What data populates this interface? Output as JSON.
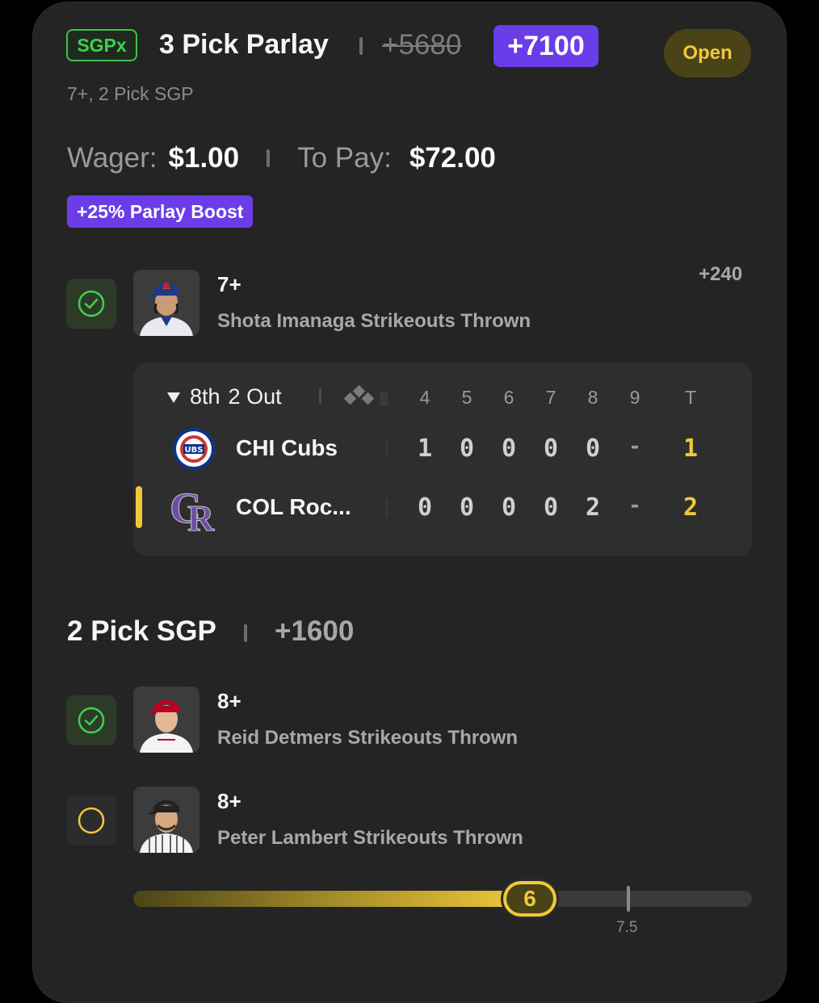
{
  "header": {
    "badge": "SGPx",
    "title": "3 Pick Parlay",
    "original_odds": "+5680",
    "boosted_odds": "+7100",
    "status": "Open",
    "subtitle": "7+, 2 Pick SGP"
  },
  "wager": {
    "wager_label": "Wager:",
    "wager_value": "$1.00",
    "payout_label": "To Pay:",
    "payout_value": "$72.00",
    "boost_label": "+25% Parlay Boost"
  },
  "picks": [
    {
      "line": "7+",
      "description": "Shota Imanaga Strikeouts Thrown",
      "odds": "+240",
      "status": "won"
    },
    {
      "line": "8+",
      "description": "Reid Detmers Strikeouts Thrown",
      "status": "won"
    },
    {
      "line": "8+",
      "description": "Peter Lambert Strikeouts Thrown",
      "status": "open"
    }
  ],
  "scoreboard": {
    "inning": "8th",
    "outs": "2 Out",
    "innings": [
      "4",
      "5",
      "6",
      "7",
      "8",
      "9"
    ],
    "total_label": "T",
    "teams": [
      {
        "name": "CHI Cubs",
        "scores": [
          "1",
          "0",
          "0",
          "0",
          "0",
          "-"
        ],
        "total": "1",
        "batting": false
      },
      {
        "name": "COL Roc...",
        "scores": [
          "0",
          "0",
          "0",
          "0",
          "2",
          "-"
        ],
        "total": "2",
        "batting": true
      }
    ]
  },
  "sgp_section": {
    "title": "2 Pick SGP",
    "odds": "+1600"
  },
  "progress": {
    "current": "6",
    "current_value": 6,
    "target": "7.5",
    "target_value": 7.5
  },
  "colors": {
    "background": "#242424",
    "accent_purple": "#6a3de8",
    "accent_gold": "#f0c93a",
    "success_green": "#3fd14d"
  },
  "icons": {
    "won": "check-circle-icon",
    "open": "empty-circle-icon",
    "inning_arrow": "triangle-down-icon",
    "bases": "bases-diamond-icon"
  }
}
